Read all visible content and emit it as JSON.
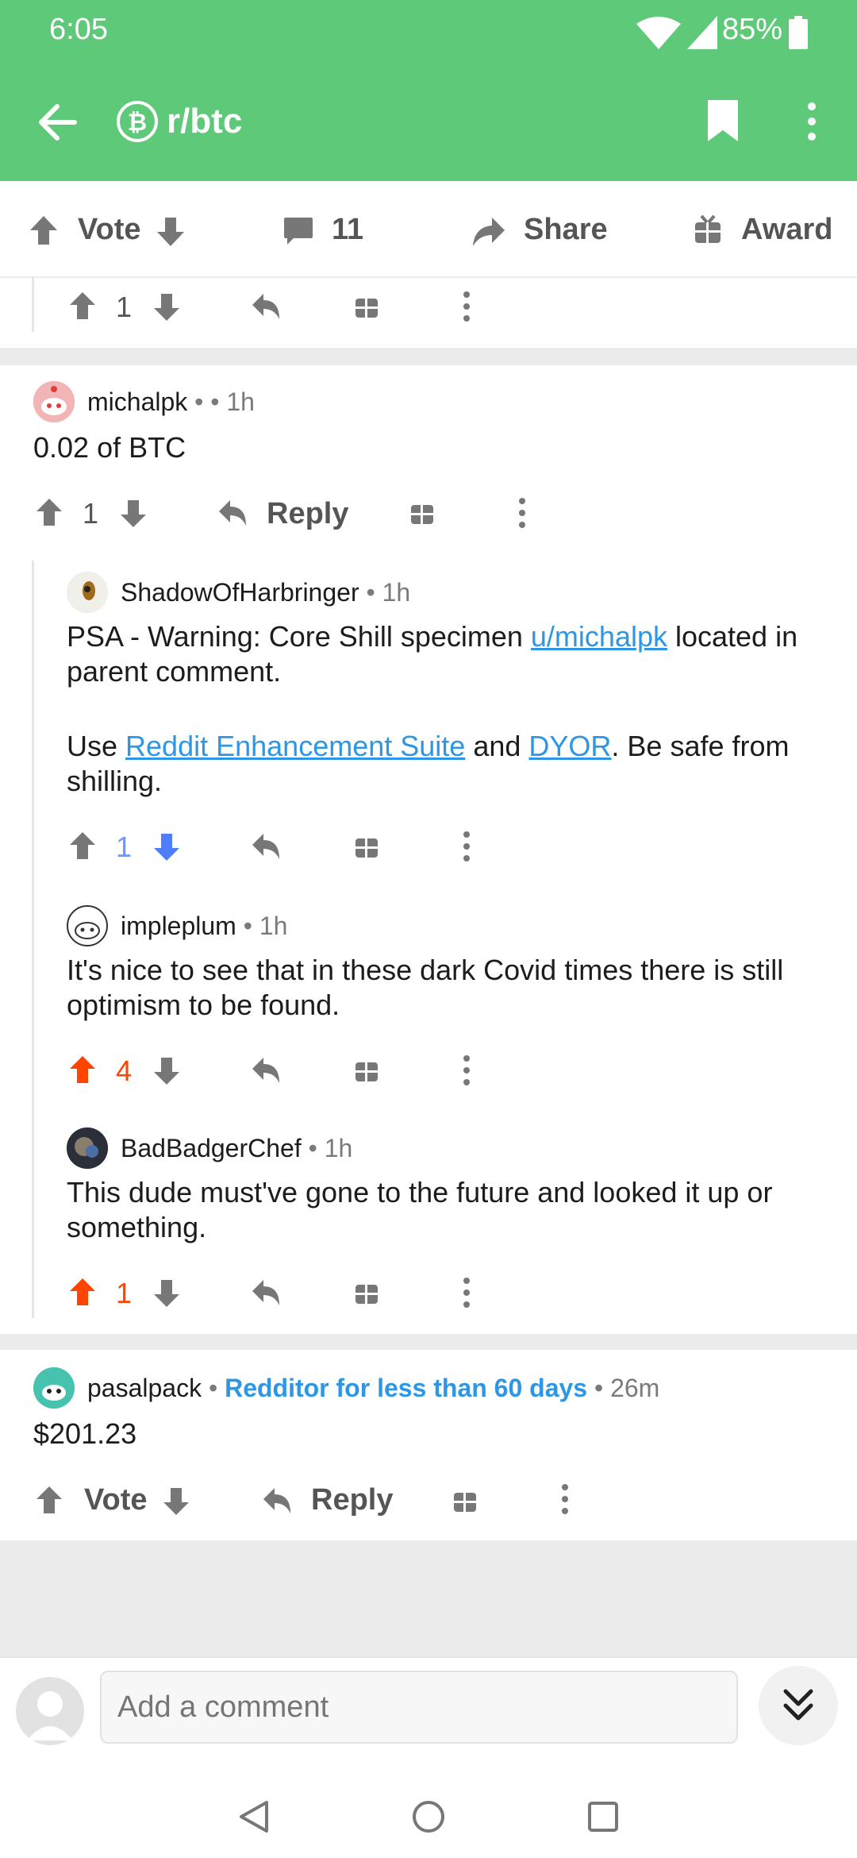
{
  "status_bar": {
    "time": "6:05",
    "battery": "85%"
  },
  "app_bar": {
    "subreddit": "r/btc"
  },
  "post_actions": {
    "vote_label": "Vote",
    "comments_count": "11",
    "share_label": "Share",
    "award_label": "Award"
  },
  "comments": [
    {
      "id": "prev-comment",
      "score": "1"
    },
    {
      "author": "michalpk",
      "sep": "•",
      "sep2": "• 1h",
      "body": "0.02 of BTC",
      "score": "1",
      "reply_label": "Reply"
    },
    {
      "author": "ShadowOfHarbringer",
      "age": "• 1h",
      "body_part1": "PSA - Warning: Core Shill specimen ",
      "body_link1": "u/michalpk",
      "body_part2": " located in parent comment.",
      "body_part3": "Use ",
      "body_link2": "Reddit Enhancement Suite",
      "body_part4": " and ",
      "body_link3": "DYOR",
      "body_part5": ". Be safe from shilling.",
      "score": "1"
    },
    {
      "author": "impleplum",
      "age": "• 1h",
      "body": "It's nice to see that in these dark Covid times there is still optimism to be found.",
      "score": "4"
    },
    {
      "author": "BadBadgerChef",
      "age": "• 1h",
      "body": "This dude must've gone to the future and looked it up or something.",
      "score": "1"
    },
    {
      "author": "pasalpack",
      "sep": "•",
      "flair": "Redditor for less than 60 days",
      "age": "• 26m",
      "body": "$201.23",
      "score_label": "Vote",
      "reply_label": "Reply"
    }
  ],
  "comment_bar": {
    "placeholder": "Add a comment"
  },
  "colors": {
    "header": "#5ec978",
    "upvote": "#ff4500",
    "downvote": "#7193ff",
    "link": "#2d97e5",
    "flair": "#2d97e5"
  },
  "icons": [
    "back-arrow-icon",
    "bitcoin-icon",
    "bookmark-icon",
    "more-vert-icon",
    "upvote-icon",
    "downvote-icon",
    "comment-icon",
    "share-icon",
    "award-icon",
    "reply-icon",
    "scroll-down-icon"
  ]
}
